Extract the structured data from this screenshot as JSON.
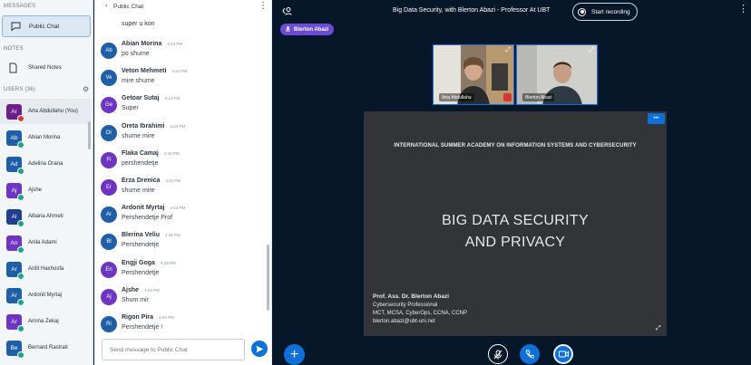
{
  "sidebar": {
    "messages_title": "MESSAGES",
    "public_chat_label": "Public Chat",
    "notes_title": "NOTES",
    "shared_notes_label": "Shared Notes",
    "users_title": "USERS (36)",
    "users": [
      {
        "initials": "Ar",
        "name": "Arta Abdullahu (You)",
        "color": "#6b1f8a",
        "badge": "#d7372f"
      },
      {
        "initials": "Ab",
        "name": "Abian Morina",
        "color": "#1f5fa8",
        "badge": "#19a58e"
      },
      {
        "initials": "Ad",
        "name": "Adelina Orana",
        "color": "#1f5fa8",
        "badge": "#19a58e"
      },
      {
        "initials": "Aj",
        "name": "Ajshe",
        "color": "#6d35c2",
        "badge": "#19a58e"
      },
      {
        "initials": "Al",
        "name": "Albana Ahmeti",
        "color": "#203d8e",
        "badge": "#19a58e"
      },
      {
        "initials": "An",
        "name": "Anila Adami",
        "color": "#6d35c2",
        "badge": "#19a58e"
      },
      {
        "initials": "Ar",
        "name": "Ardit Haxhosfa",
        "color": "#1f5fa8",
        "badge": "#19a58e"
      },
      {
        "initials": "Ar",
        "name": "Ardonit Myrtaj",
        "color": "#1f5fa8",
        "badge": "#19a58e"
      },
      {
        "initials": "Ar",
        "name": "Arnina Zekaj",
        "color": "#6d35c2",
        "badge": "#19a58e"
      },
      {
        "initials": "Be",
        "name": "Bernard Rastrati",
        "color": "#1f5fa8",
        "badge": "#19a58e"
      }
    ]
  },
  "chat": {
    "title": "Public Chat",
    "first_line": "super u kon",
    "messages": [
      {
        "initials": "Ab",
        "name": "Abian Morina",
        "time": "4:24 PM",
        "text": "po shume",
        "color": "#1f5fa8"
      },
      {
        "initials": "Ve",
        "name": "Veton Mehmeti",
        "time": "4:24 PM",
        "text": "mire shume",
        "color": "#1f5fa8"
      },
      {
        "initials": "Ge",
        "name": "Getoar Sutaj",
        "time": "4:24 PM",
        "text": "Super",
        "color": "#6d35c2"
      },
      {
        "initials": "Or",
        "name": "Oreta Ibrahimi",
        "time": "4:24 PM",
        "text": "shume mire",
        "color": "#1f5fa8"
      },
      {
        "initials": "Fl",
        "name": "Flaka Camaj",
        "time": "4:24 PM",
        "text": "pershendetje",
        "color": "#6d35c2"
      },
      {
        "initials": "Er",
        "name": "Erza Drenica",
        "time": "4:24 PM",
        "text": "shume mire",
        "color": "#6d35c2"
      },
      {
        "initials": "Ar",
        "name": "Ardonit Myrtaj",
        "time": "4:24 PM",
        "text": "Pershendetje Prof",
        "color": "#1f5fa8"
      },
      {
        "initials": "Bl",
        "name": "Blerina Veliu",
        "time": "4:25 PM",
        "text": "Pershendetje",
        "color": "#1f5fa8"
      },
      {
        "initials": "En",
        "name": "Engji Goga",
        "time": "4:25 PM",
        "text": "Pershendetje",
        "color": "#6d35c2"
      },
      {
        "initials": "Aj",
        "name": "Ajshe",
        "time": "4:25 PM",
        "text": "Shum mir",
        "color": "#6d35c2"
      },
      {
        "initials": "Ri",
        "name": "Rigon Pira",
        "time": "4:25 PM",
        "text": "Pershendetje !",
        "color": "#1f5fa8"
      }
    ],
    "input_placeholder": "Send message to Public Chat"
  },
  "stage": {
    "conference_title": "Big Data Security, with Blerton Abazi - Professor At UBT",
    "record_label": "Start recording",
    "talker_label": "Blerton Abazi",
    "videos": [
      {
        "name": "Arta Abdullahu"
      },
      {
        "name": "Blerton Abazi"
      }
    ],
    "slide": {
      "academy": "INTERNATIONAL SUMMER ACADEMY ON INFORMATION SYSTEMS AND CYBERSECURITY",
      "title_line1": "BIG DATA SECURITY",
      "title_line2": "AND PRIVACY",
      "author": "Prof. Ass. Dr. Blerton Abazi",
      "role": "Cybersecurity Professional",
      "certs": "MCT, MCSA, CyberOps, CCNA, CCNP",
      "email": "blerton.abazi@ubt-uni.net"
    }
  },
  "colors": {
    "accent": "#0f70d7",
    "stage_bg": "#06172a",
    "talker": "#6c4bd6",
    "mute_red": "#d7372f"
  }
}
